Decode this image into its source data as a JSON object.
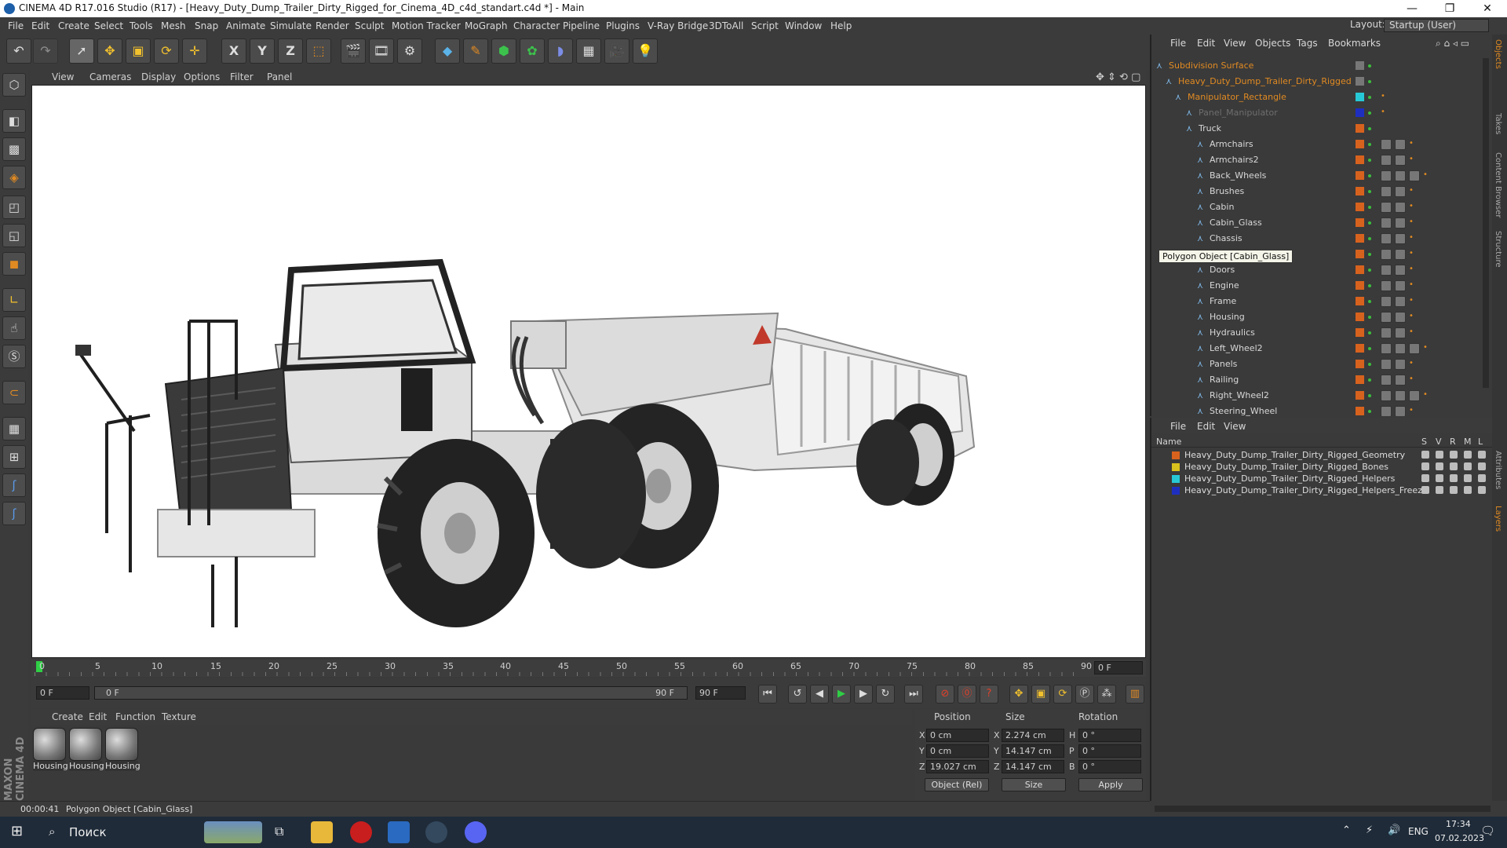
{
  "titlebar": {
    "title": "CINEMA 4D R17.016 Studio (R17) - [Heavy_Duty_Dump_Trailer_Dirty_Rigged_for_Cinema_4D_c4d_standart.c4d *] - Main",
    "minimize": "—",
    "maximize": "❐",
    "close": "✕"
  },
  "menubar": {
    "items": [
      "File",
      "Edit",
      "Create",
      "Select",
      "Tools",
      "Mesh",
      "Snap",
      "Animate",
      "Simulate",
      "Render",
      "Sculpt",
      "Motion Tracker",
      "MoGraph",
      "Character",
      "Pipeline",
      "Plugins",
      "V-Ray Bridge",
      "3DToAll",
      "Script",
      "Window",
      "Help"
    ],
    "layout_label": "Layout:",
    "layout_value": "Startup (User)"
  },
  "toolbar": {
    "icons": [
      "undo-icon",
      "redo-icon",
      "select-arrow-icon",
      "move-icon",
      "scale-icon",
      "rotate-icon",
      "live-select-icon",
      "x-axis-icon",
      "y-axis-icon",
      "z-axis-icon",
      "coordinate-system-icon",
      "render-view-icon",
      "render-picture-viewer-icon",
      "render-settings-icon",
      "cube-icon",
      "pen-spline-icon",
      "subdivision-icon",
      "array-icon",
      "deformer-icon",
      "floor-icon",
      "camera-icon",
      "light-icon"
    ],
    "axis_labels": [
      "X",
      "Y",
      "Z"
    ]
  },
  "viewport_menu": [
    "View",
    "Cameras",
    "Display",
    "Options",
    "Filter",
    "Panel"
  ],
  "timeline": {
    "ticks": [
      "0",
      "5",
      "10",
      "15",
      "20",
      "25",
      "30",
      "35",
      "40",
      "45",
      "50",
      "55",
      "60",
      "65",
      "70",
      "75",
      "80",
      "85",
      "90"
    ],
    "current_frame": "0 F",
    "start_field": "0 F",
    "range_start": "0 F",
    "range_end": "90 F",
    "end_field": "90 F"
  },
  "material_menu": [
    "Create",
    "Edit",
    "Function",
    "Texture"
  ],
  "materials": [
    "Housing",
    "Housing",
    "Housing"
  ],
  "coords": {
    "headers": [
      "Position",
      "Size",
      "Rotation"
    ],
    "position": {
      "x": "0 cm",
      "y": "0 cm",
      "z": "19.027 cm"
    },
    "size": {
      "x": "2.274 cm",
      "y": "14.147 cm",
      "z": "14.147 cm"
    },
    "rotation": {
      "h": "0 °",
      "p": "0 °",
      "b": "0 °"
    },
    "axis_pos": [
      "X",
      "Y",
      "Z"
    ],
    "axis_size": [
      "X",
      "Y",
      "Z"
    ],
    "axis_rot": [
      "H",
      "P",
      "B"
    ],
    "mode_select": "Object (Rel)",
    "size_select": "Size",
    "apply": "Apply"
  },
  "statusbar": {
    "time": "00:00:41",
    "message": "Polygon Object [Cabin_Glass]"
  },
  "object_manager": {
    "menu": [
      "File",
      "Edit",
      "View",
      "Objects",
      "Tags",
      "Bookmarks"
    ],
    "items": [
      {
        "name": "Subdivision Surface",
        "color": "#e08a22"
      },
      {
        "name": "Heavy_Duty_Dump_Trailer_Dirty_Rigged",
        "color": "#e08a22"
      },
      {
        "name": "Manipulator_Rectangle",
        "color": "#e08a22"
      },
      {
        "name": "Panel_Manipulator",
        "color": "#6e6e6e"
      },
      {
        "name": "Truck",
        "color": "#d8d8d8"
      },
      {
        "name": "Armchairs",
        "color": "#d8d8d8"
      },
      {
        "name": "Armchairs2",
        "color": "#d8d8d8"
      },
      {
        "name": "Back_Wheels",
        "color": "#d8d8d8"
      },
      {
        "name": "Brushes",
        "color": "#d8d8d8"
      },
      {
        "name": "Cabin",
        "color": "#d8d8d8"
      },
      {
        "name": "Cabin_Glass",
        "color": "#d8d8d8"
      },
      {
        "name": "Chassis",
        "color": "#d8d8d8"
      },
      {
        "name": "",
        "color": "#d8d8d8"
      },
      {
        "name": "Doors",
        "color": "#d8d8d8"
      },
      {
        "name": "Engine",
        "color": "#d8d8d8"
      },
      {
        "name": "Frame",
        "color": "#d8d8d8"
      },
      {
        "name": "Housing",
        "color": "#d8d8d8"
      },
      {
        "name": "Hydraulics",
        "color": "#d8d8d8"
      },
      {
        "name": "Left_Wheel2",
        "color": "#d8d8d8"
      },
      {
        "name": "Panels",
        "color": "#d8d8d8"
      },
      {
        "name": "Railing",
        "color": "#d8d8d8"
      },
      {
        "name": "Right_Wheel2",
        "color": "#d8d8d8"
      },
      {
        "name": "Steering_Wheel",
        "color": "#d8d8d8"
      }
    ],
    "tooltip": "Polygon Object [Cabin_Glass]"
  },
  "layer_manager": {
    "menu": [
      "File",
      "Edit",
      "View"
    ],
    "columns": [
      "Name",
      "S",
      "V",
      "R",
      "M",
      "L"
    ],
    "layers": [
      {
        "name": "Heavy_Duty_Dump_Trailer_Dirty_Rigged_Geometry",
        "color": "#d7621e"
      },
      {
        "name": "Heavy_Duty_Dump_Trailer_Dirty_Rigged_Bones",
        "color": "#d8c21e"
      },
      {
        "name": "Heavy_Duty_Dump_Trailer_Dirty_Rigged_Helpers",
        "color": "#27c8d6"
      },
      {
        "name": "Heavy_Duty_Dump_Trailer_Dirty_Rigged_Helpers_Freeze",
        "color": "#1e2fc0"
      }
    ]
  },
  "right_tabs": [
    "Objects",
    "Takes",
    "Content Browser",
    "Structure",
    "Attributes",
    "Layers"
  ],
  "maxon_logo": "MAXON CINEMA 4D",
  "taskbar": {
    "search": "Поиск",
    "lang": "ENG",
    "time": "17:34",
    "date": "07.02.2023"
  }
}
